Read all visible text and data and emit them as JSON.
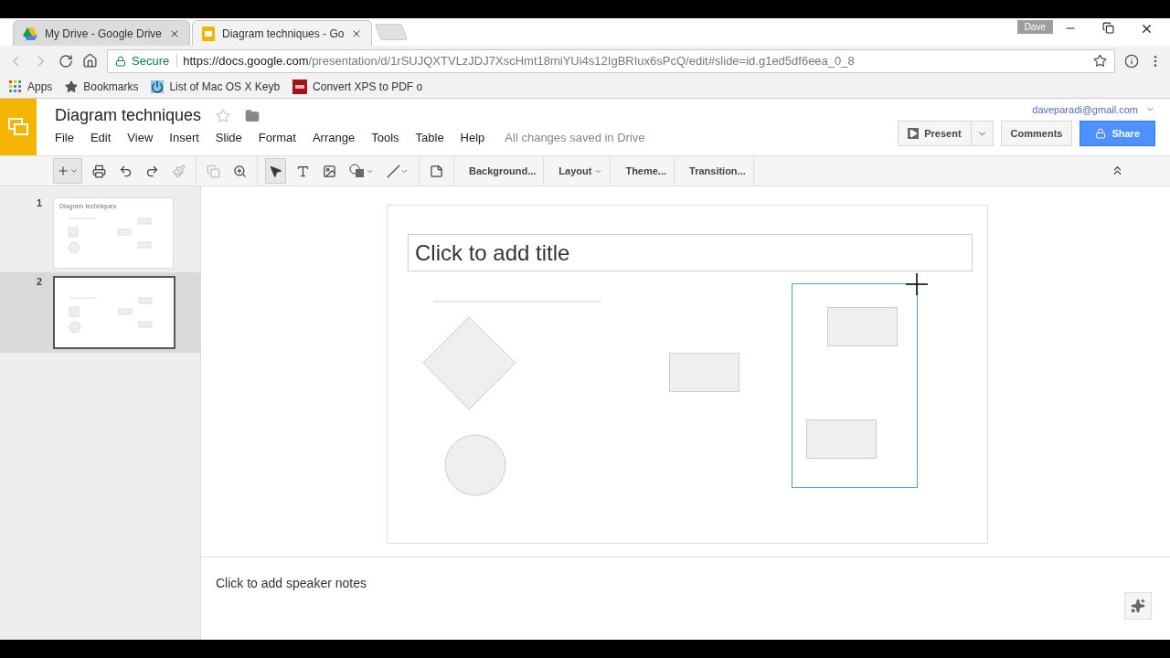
{
  "browser": {
    "tabs": [
      {
        "title": "My Drive - Google Drive",
        "kind": "drive",
        "selected": false
      },
      {
        "title": "Diagram techniques - Go",
        "kind": "slides",
        "selected": true
      }
    ],
    "profile": "Dave",
    "secure_label": "Secure",
    "url_host": "https://docs.google.com",
    "url_path": "/presentation/d/1rSUJQXTVLzJDJ7XscHmt18miYUi4s12IgBRIux6sPcQ/edit#slide=id.g1ed5df6eea_0_8",
    "bookmarks": [
      {
        "label": "Apps",
        "kind": "apps"
      },
      {
        "label": "Bookmarks",
        "kind": "star"
      },
      {
        "label": "List of Mac OS X Keyb",
        "kind": "power"
      },
      {
        "label": "Convert XPS to PDF o",
        "kind": "pdf"
      }
    ]
  },
  "document": {
    "title": "Diagram techniques",
    "account": "daveparadi@gmail.com",
    "menus": [
      "File",
      "Edit",
      "View",
      "Insert",
      "Slide",
      "Format",
      "Arrange",
      "Tools",
      "Table",
      "Help"
    ],
    "save_status": "All changes saved in Drive",
    "buttons": {
      "present": "Present",
      "comments": "Comments",
      "share": "Share"
    }
  },
  "toolbar": {
    "text_buttons": [
      {
        "label": "Background...",
        "dropdown": false
      },
      {
        "label": "Layout",
        "dropdown": true
      },
      {
        "label": "Theme...",
        "dropdown": false
      },
      {
        "label": "Transition...",
        "dropdown": false
      }
    ]
  },
  "slides": [
    {
      "number": "1",
      "selected": false,
      "thumb_title": "Diagram techniques"
    },
    {
      "number": "2",
      "selected": true
    }
  ],
  "slide": {
    "title_placeholder": "Click to add title"
  },
  "notes": {
    "placeholder": "Click to add speaker notes"
  }
}
